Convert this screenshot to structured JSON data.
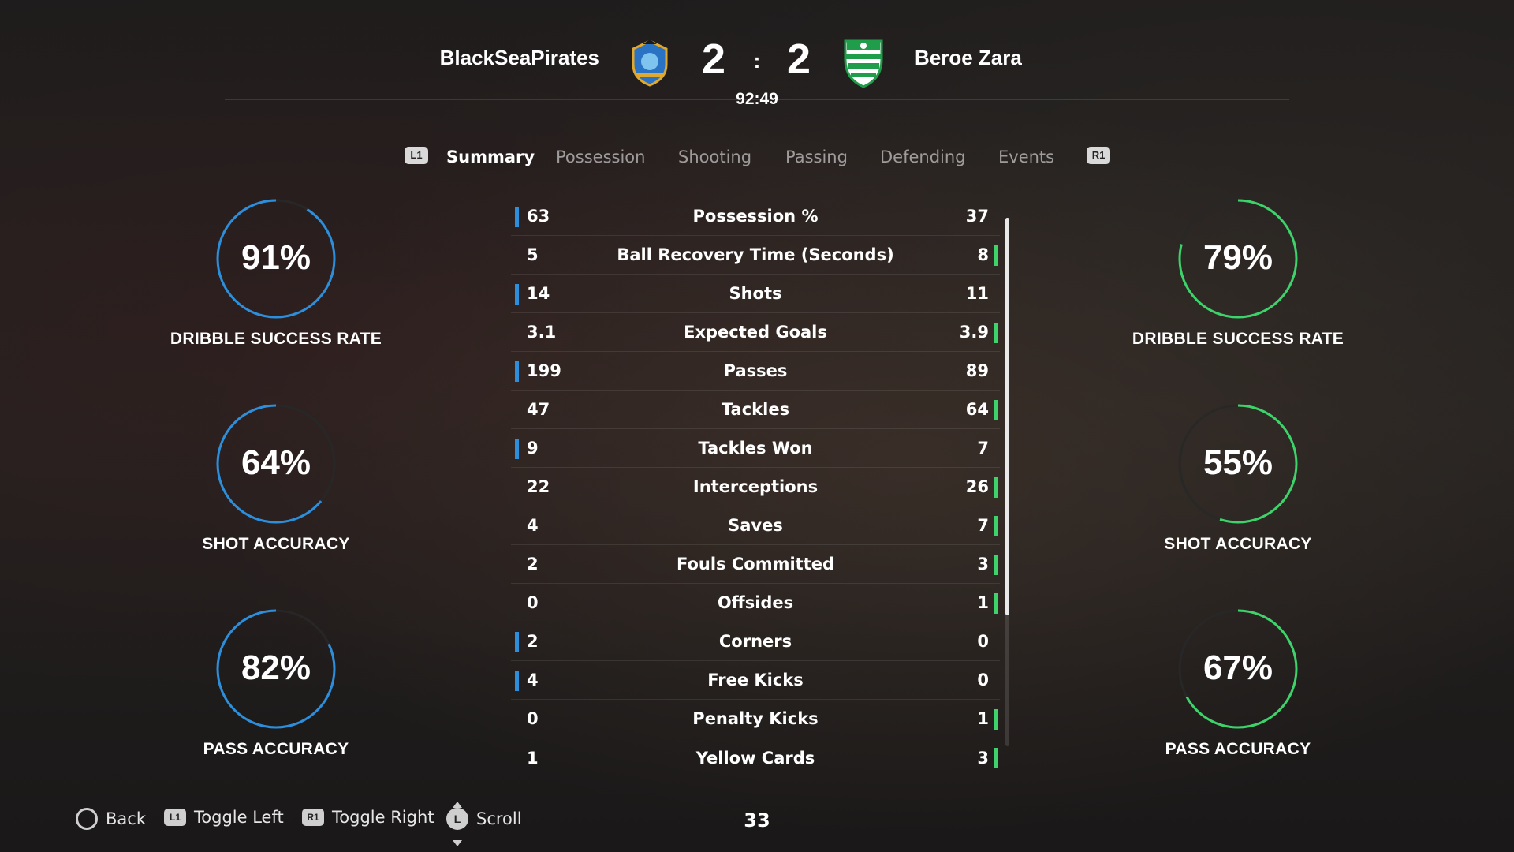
{
  "header": {
    "home_team": "BlackSeaPirates",
    "away_team": "Beroe Zara",
    "home_score": "2",
    "away_score": "2",
    "score_separator": ":",
    "clock": "92:49"
  },
  "tabs": {
    "left_button": "L1",
    "right_button": "R1",
    "items": [
      "Summary",
      "Possession",
      "Shooting",
      "Passing",
      "Defending",
      "Events"
    ],
    "active": "Summary"
  },
  "colors": {
    "home_accent": "#2d8fdc",
    "away_accent": "#3ed36a"
  },
  "home_rings": [
    {
      "value": "91%",
      "label": "DRIBBLE SUCCESS RATE",
      "fraction": 0.91
    },
    {
      "value": "64%",
      "label": "SHOT ACCURACY",
      "fraction": 0.64
    },
    {
      "value": "82%",
      "label": "PASS ACCURACY",
      "fraction": 0.82
    }
  ],
  "away_rings": [
    {
      "value": "79%",
      "label": "DRIBBLE SUCCESS RATE",
      "fraction": 0.79
    },
    {
      "value": "55%",
      "label": "SHOT ACCURACY",
      "fraction": 0.55
    },
    {
      "value": "67%",
      "label": "PASS ACCURACY",
      "fraction": 0.67
    }
  ],
  "stats": [
    {
      "name": "Possession %",
      "home": "63",
      "away": "37",
      "leader": "home"
    },
    {
      "name": "Ball Recovery Time (Seconds)",
      "home": "5",
      "away": "8",
      "leader": "away"
    },
    {
      "name": "Shots",
      "home": "14",
      "away": "11",
      "leader": "home"
    },
    {
      "name": "Expected Goals",
      "home": "3.1",
      "away": "3.9",
      "leader": "away"
    },
    {
      "name": "Passes",
      "home": "199",
      "away": "89",
      "leader": "home"
    },
    {
      "name": "Tackles",
      "home": "47",
      "away": "64",
      "leader": "away"
    },
    {
      "name": "Tackles Won",
      "home": "9",
      "away": "7",
      "leader": "home"
    },
    {
      "name": "Interceptions",
      "home": "22",
      "away": "26",
      "leader": "away"
    },
    {
      "name": "Saves",
      "home": "4",
      "away": "7",
      "leader": "away"
    },
    {
      "name": "Fouls Committed",
      "home": "2",
      "away": "3",
      "leader": "away"
    },
    {
      "name": "Offsides",
      "home": "0",
      "away": "1",
      "leader": "away"
    },
    {
      "name": "Corners",
      "home": "2",
      "away": "0",
      "leader": "home"
    },
    {
      "name": "Free Kicks",
      "home": "4",
      "away": "0",
      "leader": "home"
    },
    {
      "name": "Penalty Kicks",
      "home": "0",
      "away": "1",
      "leader": "away"
    },
    {
      "name": "Yellow Cards",
      "home": "1",
      "away": "3",
      "leader": "away"
    }
  ],
  "footer": {
    "back": "Back",
    "toggle_left_chip": "L1",
    "toggle_left": "Toggle Left",
    "toggle_right_chip": "R1",
    "toggle_right": "Toggle Right",
    "scroll_chip": "L",
    "scroll": "Scroll",
    "page_number": "33"
  }
}
